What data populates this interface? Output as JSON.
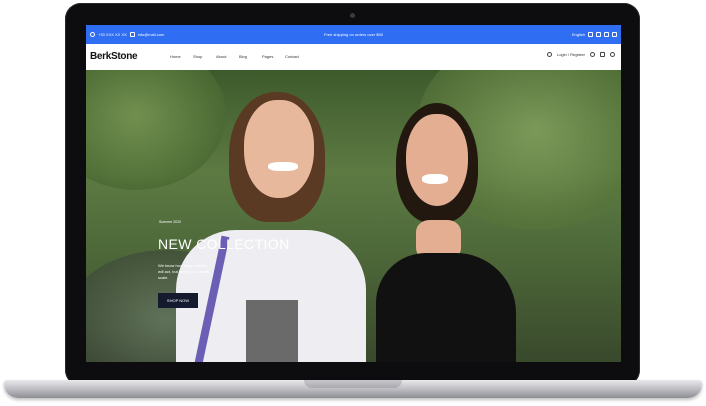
{
  "topbar": {
    "phone": "+33 XXX XX XX",
    "email": "info@mail.com",
    "announcement": "Free shipping on orders over $50",
    "language": "English",
    "accent": "#2f6df2"
  },
  "header": {
    "logo": "BerkStone",
    "nav": [
      "Home",
      "Shop",
      "About",
      "Blog",
      "Pages",
      "Contact"
    ],
    "account_label": "Login / Register"
  },
  "hero": {
    "subtitle": "Summer 2020",
    "title": "NEW COLLECTION",
    "description": "We know how large objects will act, but things on a small scale.",
    "cta": "SHOP NOW"
  }
}
